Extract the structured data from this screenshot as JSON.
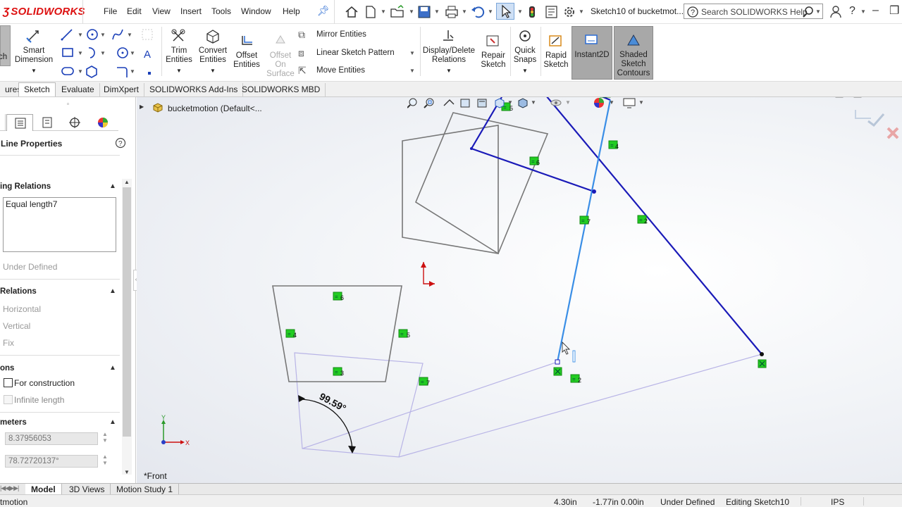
{
  "app": {
    "logo_text": "SOLIDWORKS",
    "menu": [
      "File",
      "Edit",
      "View",
      "Insert",
      "Tools",
      "Window",
      "Help"
    ],
    "document_title": "Sketch10 of bucketmot...",
    "search_placeholder": "Search SOLIDWORKS Help"
  },
  "ribbon": {
    "partial_left": "ch",
    "smart_dimension": [
      "Smart",
      "Dimension"
    ],
    "trim_entities": [
      "Trim",
      "Entities"
    ],
    "convert_entities": [
      "Convert",
      "Entities"
    ],
    "offset_entities": [
      "Offset",
      "Entities"
    ],
    "offset_on_surface": [
      "Offset",
      "On",
      "Surface"
    ],
    "mirror_entities": "Mirror Entities",
    "linear_sketch_pattern": "Linear Sketch Pattern",
    "move_entities": "Move Entities",
    "display_delete_relations": [
      "Display/Delete",
      "Relations"
    ],
    "repair_sketch": [
      "Repair",
      "Sketch"
    ],
    "quick_snaps": [
      "Quick",
      "Snaps"
    ],
    "rapid_sketch": [
      "Rapid",
      "Sketch"
    ],
    "instant2d": "Instant2D",
    "shaded_sketch_contours": [
      "Shaded",
      "Sketch",
      "Contours"
    ]
  },
  "tabs": [
    "ures",
    "Sketch",
    "Evaluate",
    "DimXpert",
    "SOLIDWORKS Add-Ins",
    "SOLIDWORKS MBD"
  ],
  "active_tab": "Sketch",
  "property_manager": {
    "title": "Line Properties",
    "existing_relations_header": "ing Relations",
    "relations_list": [
      "Equal length7"
    ],
    "status_text": "Under Defined",
    "add_relations_header": "Relations",
    "add_relations": [
      "Horizontal",
      "Vertical",
      "Fix"
    ],
    "options_header": "ons",
    "for_construction_label": "For construction",
    "infinite_length_label": "Infinite length",
    "parameters_header": "meters",
    "length_value": "8.37956053",
    "angle_value": "78.72720137°"
  },
  "feature_tree": {
    "root_label": "bucketmotion  (Default<..."
  },
  "viewport": {
    "view_label": "*Front",
    "dimension_label": "99.59°",
    "axis_x": "X",
    "axis_y": "Y",
    "relation_tags": [
      "5",
      "6",
      "4",
      "7",
      "2",
      "6",
      "4",
      "5",
      "3",
      "7",
      "2"
    ]
  },
  "bottom_tabs": [
    "Model",
    "3D Views",
    "Motion Study 1"
  ],
  "active_bottom_tab": "Model",
  "status_bar": {
    "left": "tmotion",
    "x": "4.30in",
    "y": "-1.77in",
    "z": "0.00in",
    "state": "Under Defined",
    "editing": "Editing Sketch10",
    "units": "IPS"
  },
  "colors": {
    "brand_red": "#d11a1a",
    "sketch_blue": "#1a1ab8",
    "selected_line": "#3a8ee6",
    "construction": "#b8b4e6",
    "relation_green": "#22cc22",
    "highlight_button": "#a8a8a8"
  }
}
